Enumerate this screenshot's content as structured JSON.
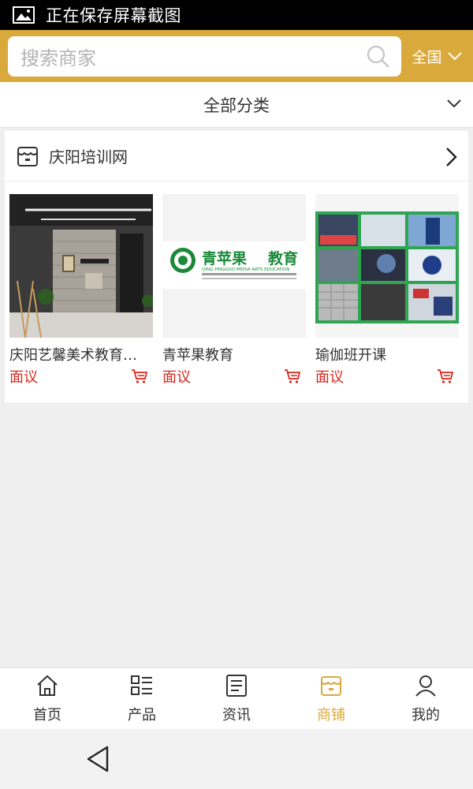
{
  "status": {
    "text": "正在保存屏幕截图",
    "icon": "image-icon"
  },
  "search": {
    "placeholder": "搜索商家",
    "region": "全国"
  },
  "category": {
    "label": "全部分类"
  },
  "shop": {
    "name": "庆阳培训网",
    "products": [
      {
        "title": "庆阳艺馨美术教育…",
        "price": "面议"
      },
      {
        "title": "青苹果教育",
        "price": "面议"
      },
      {
        "title": "瑜伽班开课",
        "price": "面议"
      }
    ]
  },
  "tabs": [
    {
      "label": "首页",
      "icon": "home-icon"
    },
    {
      "label": "产品",
      "icon": "list-icon"
    },
    {
      "label": "资讯",
      "icon": "news-icon"
    },
    {
      "label": "商铺",
      "icon": "store-icon",
      "active": true
    },
    {
      "label": "我的",
      "icon": "user-icon"
    }
  ],
  "colors": {
    "accent": "#d9a93c",
    "price": "#d9261c",
    "brand_green": "#1a8a3a"
  },
  "logo_text": {
    "brand": "青苹果",
    "sub": "教育",
    "line": "QING PINGGUO MEDIA ARTS EDUCATION"
  }
}
